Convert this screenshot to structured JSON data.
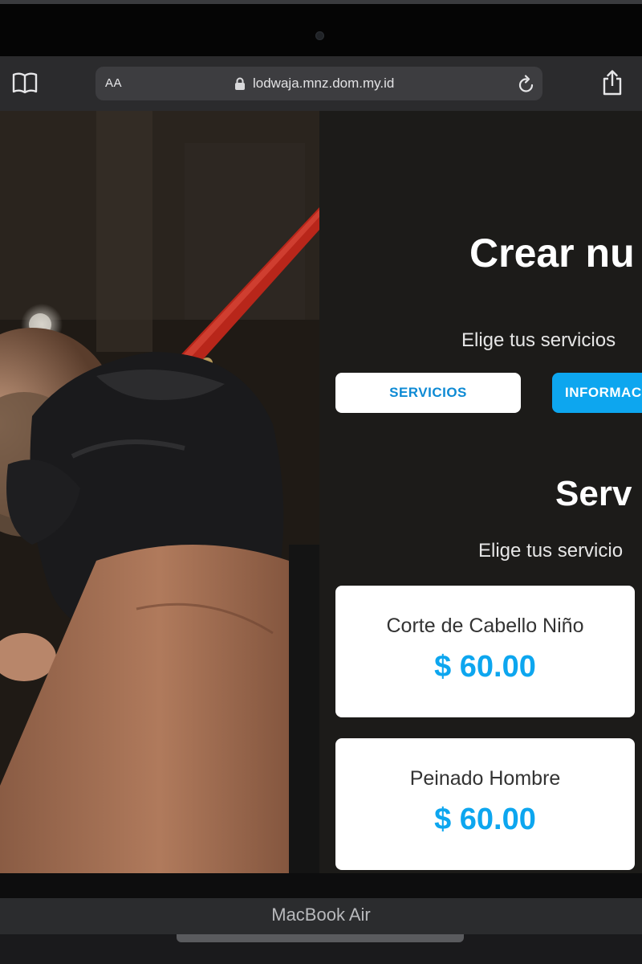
{
  "device": {
    "label": "MacBook Air"
  },
  "browser": {
    "reader_icon": "book-icon",
    "text_size_label": "AA",
    "url": "lodwaja.mnz.dom.my.id",
    "lock_icon": "lock-icon",
    "reload_icon": "reload-icon",
    "share_icon": "share-icon"
  },
  "page": {
    "hero_image": "barber-shaving-beard-photo",
    "title": "Crear nu",
    "subtitle": "Elige tus servicios",
    "tabs": [
      {
        "label": "SERVICIOS",
        "active": false
      },
      {
        "label": "INFORMAC",
        "active": true
      }
    ],
    "section": {
      "title": "Serv",
      "subtitle": "Elige tus servicio"
    },
    "services": [
      {
        "name": "Corte de Cabello Niño",
        "price": "$ 60.00"
      },
      {
        "name": "Peinado Hombre",
        "price": "$ 60.00"
      }
    ],
    "colors": {
      "accent": "#0da6ef",
      "background": "#1c1b19",
      "card": "#ffffff"
    }
  }
}
